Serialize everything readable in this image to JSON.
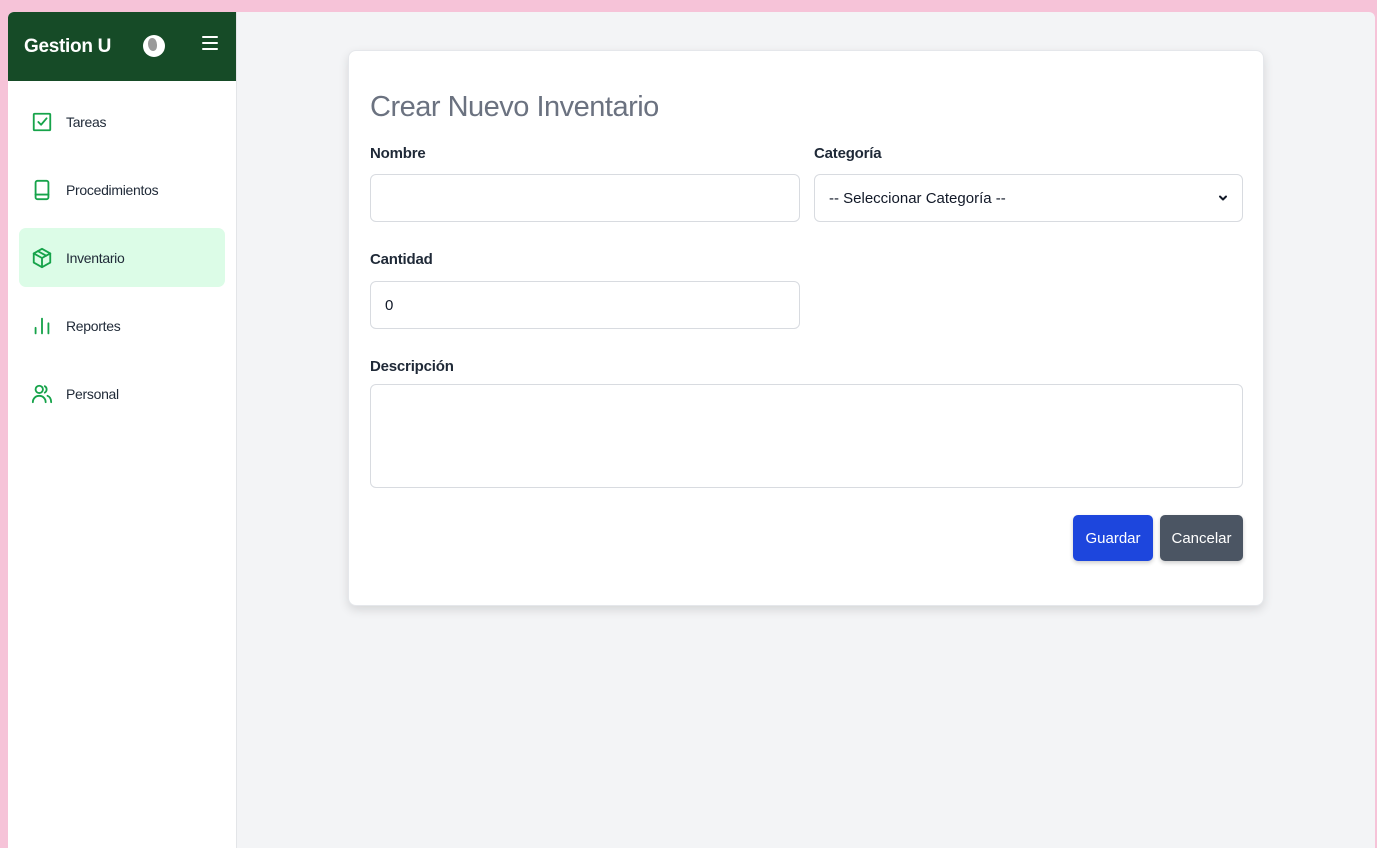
{
  "app": {
    "title": "Gestion U"
  },
  "icons": {
    "brand": "globe-icon",
    "menu": "hamburger-menu-icon"
  },
  "colors": {
    "brand_bg": "#164b27",
    "accent": "#16a34a",
    "active_bg": "#dcfce7",
    "primary": "#1d46dd",
    "secondary": "#4b5563"
  },
  "sidebar": {
    "items": [
      {
        "label": "Tareas",
        "icon": "checkbox-icon",
        "active": false
      },
      {
        "label": "Procedimientos",
        "icon": "book-icon",
        "active": false
      },
      {
        "label": "Inventario",
        "icon": "box-icon",
        "active": true
      },
      {
        "label": "Reportes",
        "icon": "bar-chart-icon",
        "active": false
      },
      {
        "label": "Personal",
        "icon": "users-icon",
        "active": false
      }
    ]
  },
  "form": {
    "title": "Crear Nuevo Inventario",
    "nombre": {
      "label": "Nombre",
      "value": ""
    },
    "categoria": {
      "label": "Categoría",
      "selected": "-- Seleccionar Categoría --"
    },
    "cantidad": {
      "label": "Cantidad",
      "value": "0"
    },
    "descripcion": {
      "label": "Descripción",
      "value": ""
    },
    "save_label": "Guardar",
    "cancel_label": "Cancelar"
  }
}
